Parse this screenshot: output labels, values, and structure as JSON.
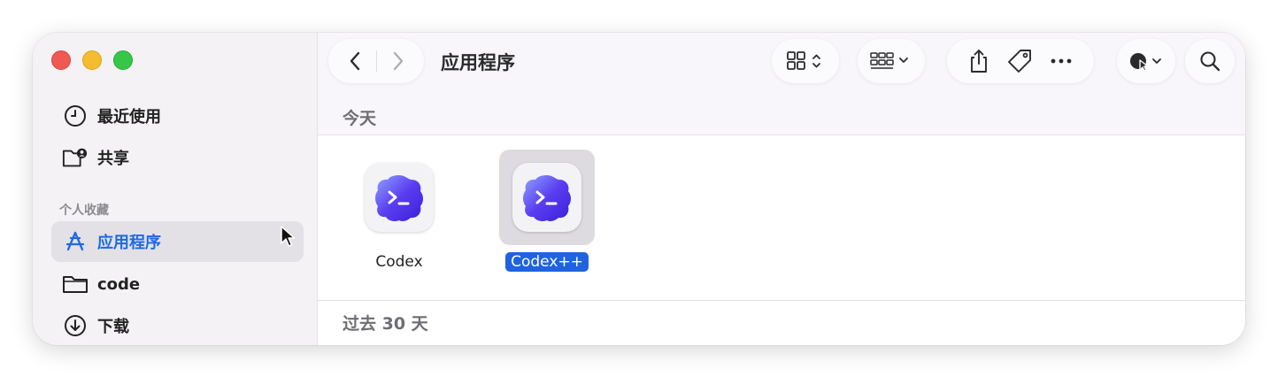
{
  "window": {
    "traffic_lights": [
      "close",
      "minimize",
      "zoom"
    ]
  },
  "sidebar": {
    "items_top": [
      {
        "label": "最近使用",
        "icon": "clock-icon"
      },
      {
        "label": "共享",
        "icon": "shared-folder-icon"
      }
    ],
    "section_label": "个人收藏",
    "favorites": [
      {
        "label": "应用程序",
        "icon": "applications-icon",
        "selected": true
      },
      {
        "label": "code",
        "icon": "folder-icon"
      },
      {
        "label": "下载",
        "icon": "download-icon"
      }
    ]
  },
  "toolbar": {
    "title": "应用程序",
    "buttons": [
      "back",
      "forward",
      "icon-view",
      "group-by",
      "share",
      "tag",
      "more",
      "quick-action",
      "search"
    ]
  },
  "content": {
    "groups": [
      {
        "title": "今天",
        "files": [
          {
            "name": "Codex",
            "icon": "codex-app-icon",
            "selected": false
          },
          {
            "name": "Codex++",
            "icon": "codex-app-icon",
            "selected": true
          }
        ]
      },
      {
        "title": "过去 30 天"
      }
    ]
  },
  "colors": {
    "accent": "#1d6ae5",
    "selection": "#1f63e0",
    "app_icon_purple": "#5a3df0"
  }
}
